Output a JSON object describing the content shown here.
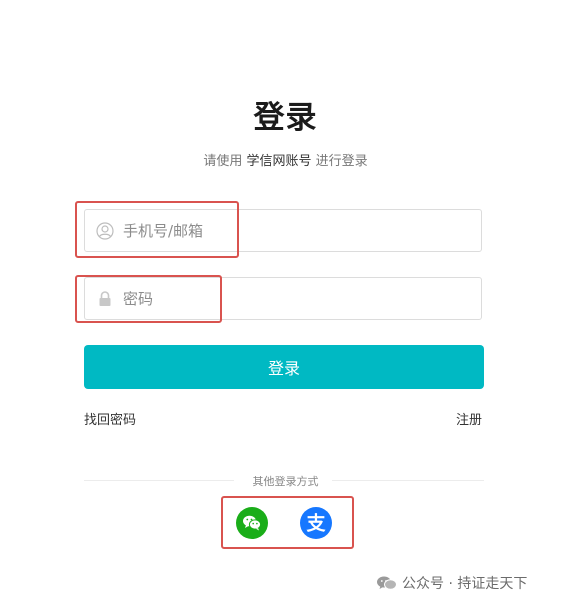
{
  "header": {
    "title": "登录",
    "subtitle_prefix": "请使用 ",
    "subtitle_brand": "学信网账号",
    "subtitle_suffix": " 进行登录"
  },
  "form": {
    "username_placeholder": "手机号/邮箱",
    "username_value": "",
    "username_icon": "user-circle-icon",
    "password_placeholder": "密码",
    "password_value": "",
    "password_icon": "lock-icon",
    "submit_label": "登录"
  },
  "links": {
    "forgot": "找回密码",
    "register": "注册"
  },
  "alt_login": {
    "label": "其他登录方式",
    "methods": [
      {
        "name": "wechat",
        "icon": "wechat-icon",
        "color": "#1aad19"
      },
      {
        "name": "alipay",
        "icon": "alipay-icon",
        "color": "#1677ff"
      }
    ]
  },
  "watermark": {
    "text": "公众号 · 持证走天下"
  },
  "colors": {
    "accent": "#00b9c3",
    "highlight_box": "#d9534f"
  }
}
